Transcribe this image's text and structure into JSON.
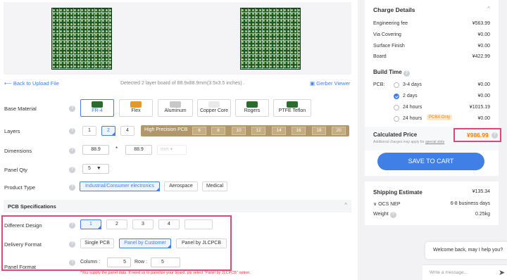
{
  "board_info": "Detected 2 layer board of 88.9x88.9mm(3.5x3.5 inches) .",
  "back_link": "Back to Upload File",
  "gerber_viewer": "Gerber Viewer",
  "labels": {
    "base_material": "Base Material",
    "layers": "Layers",
    "dimensions": "Dimensions",
    "panel_qty": "Panel Qty",
    "product_type": "Product Type",
    "different_design": "Different Design",
    "delivery_format": "Delivery Format",
    "panel_format": "Panel Format"
  },
  "materials": [
    "FR-4",
    "Flex",
    "Aluminum",
    "Copper Core",
    "Rogers",
    "PTFE Teflon"
  ],
  "layers": [
    "1",
    "2",
    "4"
  ],
  "high_precision": {
    "label": "High Precision PCB",
    "values": [
      "6",
      "8",
      "10",
      "12",
      "14",
      "16",
      "18",
      "20"
    ]
  },
  "dimensions": {
    "width": "88.9",
    "height": "88.9",
    "separator": "*",
    "unit": "mm"
  },
  "panel_qty": "5",
  "product_types": [
    "Industrial/Consumer electronics",
    "Aerospace",
    "Medical"
  ],
  "pcb_spec_title": "PCB Specifications",
  "different_design": [
    "1",
    "2",
    "3",
    "4"
  ],
  "delivery_formats": [
    "Single PCB",
    "Panel by Customer",
    "Panel by JLCPCB"
  ],
  "panel_format": {
    "column_label": "Column :",
    "column": "5",
    "row_label": "Row :",
    "row": "5",
    "note": "*You supply the panel data. If need us to panelize your board, pls select \"Panel by JLCPCB\" option."
  },
  "charge": {
    "title": "Charge Details",
    "items": [
      {
        "label": "Engineering fee",
        "value": "¥563.99"
      },
      {
        "label": "Via Covering",
        "value": "¥0.00"
      },
      {
        "label": "Surface Finish",
        "value": "¥0.00"
      },
      {
        "label": "Board",
        "value": "¥422.99"
      }
    ]
  },
  "build_time": {
    "title": "Build Time",
    "pcb_label": "PCB:",
    "options": [
      {
        "label": "3-4 days",
        "value": "¥0.00",
        "selected": false
      },
      {
        "label": "2 days",
        "value": "¥0.00",
        "selected": true
      },
      {
        "label": "24 hours",
        "value": "¥1015.19",
        "selected": false
      },
      {
        "label": "24 hours",
        "badge": "PCBA Only",
        "value": "¥0.00",
        "selected": false
      }
    ]
  },
  "calc": {
    "label": "Calculated Price",
    "value": "¥986.99",
    "note": "Additional charges may apply for",
    "note_link": "special slots"
  },
  "save_button": "SAVE TO CART",
  "shipping": {
    "title": "Shipping Estimate",
    "value": "¥135.34",
    "carrier": "OCS NEP",
    "days": "6-8 business days",
    "weight_label": "Weight",
    "weight": "0.25kg"
  },
  "chat": {
    "greeting": "Welcome back, may I help you?",
    "placeholder": "Write a message..."
  },
  "colors": {
    "accent": "#3f7fe6",
    "price": "#ff7a00",
    "highlight": "#e0457b"
  }
}
